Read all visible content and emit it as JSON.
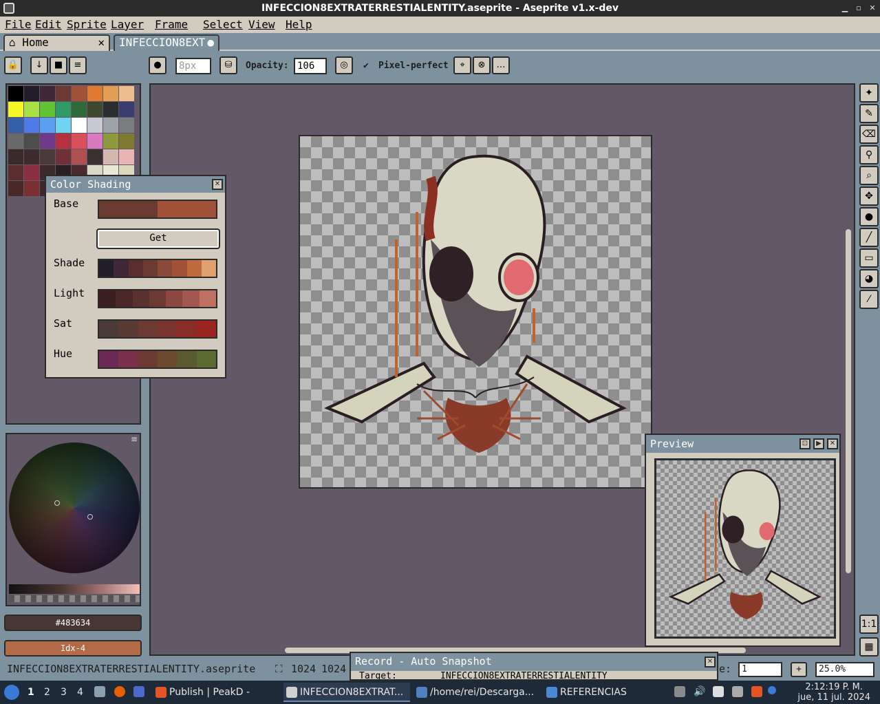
{
  "window": {
    "title": "INFECCION8EXTRATERRESTIALENTITY.aseprite - Aseprite v1.x-dev"
  },
  "menu": [
    "File",
    "Edit",
    "Sprite",
    "Layer",
    "Frame",
    "Select",
    "View",
    "Help"
  ],
  "tabs": {
    "home": "Home",
    "file": "INFECCION8EXT"
  },
  "toolbar": {
    "brush_size": "8px",
    "opacity_label": "Opacity:",
    "opacity_value": "106",
    "pixel_perfect_label": "Pixel-perfect"
  },
  "palette": {
    "swatches": [
      "#000000",
      "#221d2a",
      "#3f2838",
      "#6b3a33",
      "#a05138",
      "#e07a30",
      "#e3a055",
      "#eebd8f",
      "#f5f52a",
      "#a8e046",
      "#62c236",
      "#2f9a63",
      "#2f6b3a",
      "#3d4a2f",
      "#2b2e2e",
      "#3a3d6f",
      "#3460a8",
      "#4f7be8",
      "#5a9ef0",
      "#6fd4f0",
      "#ffffff",
      "#c8c8d2",
      "#9ea3a8",
      "#7a7c7f",
      "#6a6a6a",
      "#4d4d4d",
      "#6f3a8a",
      "#b43240",
      "#d9505a",
      "#d97ac0",
      "#8f9a3f",
      "#7f7a32",
      "#3a2a2a",
      "#3d2b2e",
      "#4a3a3a",
      "#703038",
      "#b04f4f",
      "#3a3030",
      "#d4b8b0",
      "#e8b4b4",
      "#5a2e2e",
      "#8a2f42",
      "#3a2a2e",
      "#2a2024",
      "#4a2a2c",
      "#d8d8c8",
      "#e8e8d8",
      "#dcd8c0",
      "#4a2828",
      "#7a3030",
      "#3a2828",
      "#5a3838",
      "#4a3030",
      "#6a4038",
      "#5a3a3a",
      "#3a2a28"
    ],
    "primary_color": "#483634",
    "index_label": "Idx-4"
  },
  "color_shading": {
    "title": "Color Shading",
    "base_label": "Base",
    "base_colors": [
      "#6b3a33",
      "#a05138"
    ],
    "get_label": "Get",
    "shade_label": "Shade",
    "shade_colors": [
      "#221d2a",
      "#3f2838",
      "#5a2e2e",
      "#6b3a33",
      "#8a4a3a",
      "#a05138",
      "#c06a40",
      "#e0a070"
    ],
    "light_label": "Light",
    "light_colors": [
      "#3a1e20",
      "#4a2828",
      "#5a3030",
      "#6b3a33",
      "#8a4840",
      "#a05850",
      "#c07060"
    ],
    "sat_label": "Sat",
    "sat_colors": [
      "#4a3a38",
      "#5a3a34",
      "#6b3a33",
      "#7a3430",
      "#8a2c28",
      "#9a2420"
    ],
    "hue_label": "Hue",
    "hue_colors": [
      "#6b2a55",
      "#7a2f4a",
      "#6b3a33",
      "#6b4a30",
      "#5a5a30",
      "#5a6a30"
    ]
  },
  "preview": {
    "title": "Preview"
  },
  "record": {
    "title": "Record - Auto Snapshot",
    "target_label": "Target:",
    "target_value": "INFECCION8EXTRATERRESTIALENTITY"
  },
  "status": {
    "filename": "INFECCION8EXTRATERRESTIALENTITY.aseprite",
    "width": "1024",
    "height": "1024",
    "frame_label": "e:",
    "frame_value": "1",
    "zoom": "25.0%"
  },
  "taskbar": {
    "workspaces": [
      "1",
      "2",
      "3",
      "4"
    ],
    "tasks": [
      {
        "label": "Publish | PeakD - Brave",
        "color": "#e25525"
      },
      {
        "label": "INFECCION8EXTRAT...",
        "color": "#d0d0d0"
      },
      {
        "label": "/home/rei/Descarga...",
        "color": "#5080c0"
      },
      {
        "label": "REFERENCIAS",
        "color": "#4a8ad4"
      }
    ],
    "time": "2:12:19 P. M.",
    "date": "jue, 11 jul. 2024"
  },
  "colors": {
    "accent": "#7d929e",
    "face": "#d2cbbf",
    "canvas_bg": "#625868",
    "outline": "#2b2b2b"
  }
}
